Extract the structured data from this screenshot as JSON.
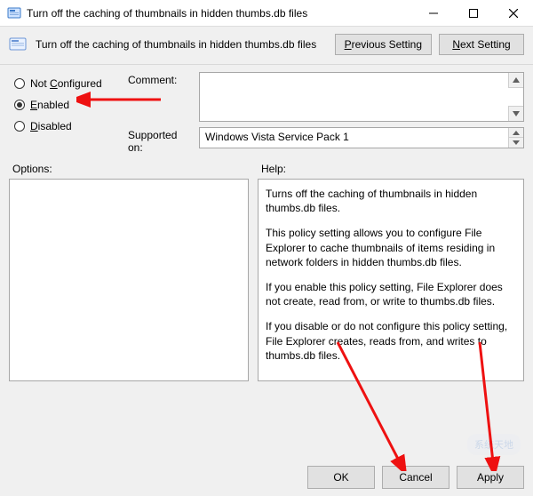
{
  "window": {
    "title": "Turn off the caching of thumbnails in hidden thumbs.db files"
  },
  "header": {
    "policy_name": "Turn off the caching of thumbnails in hidden thumbs.db files",
    "prev_label": "Previous Setting",
    "next_label": "Next Setting"
  },
  "state": {
    "not_configured": {
      "label_pre": "Not ",
      "label_u": "C",
      "label_post": "onfigured"
    },
    "enabled": {
      "label_u": "E",
      "label_post": "nabled"
    },
    "disabled": {
      "label_u": "D",
      "label_post": "isabled"
    },
    "selected": "enabled"
  },
  "fields": {
    "comment_label": "Comment:",
    "comment_value": "",
    "supported_label": "Supported on:",
    "supported_value": "Windows Vista Service Pack 1"
  },
  "sections": {
    "options_label": "Options:",
    "help_label": "Help:"
  },
  "help": {
    "p1": "Turns off the caching of thumbnails in hidden thumbs.db files.",
    "p2": "This policy setting allows you to configure File Explorer to cache thumbnails of items residing in network folders in hidden thumbs.db files.",
    "p3": "If you enable this policy setting, File Explorer does not create, read from, or write to thumbs.db files.",
    "p4": "If you disable or do not configure this policy setting, File Explorer creates, reads from, and writes to thumbs.db files."
  },
  "footer": {
    "ok": "OK",
    "cancel": "Cancel",
    "apply": "Apply"
  },
  "watermark": "系统天地"
}
